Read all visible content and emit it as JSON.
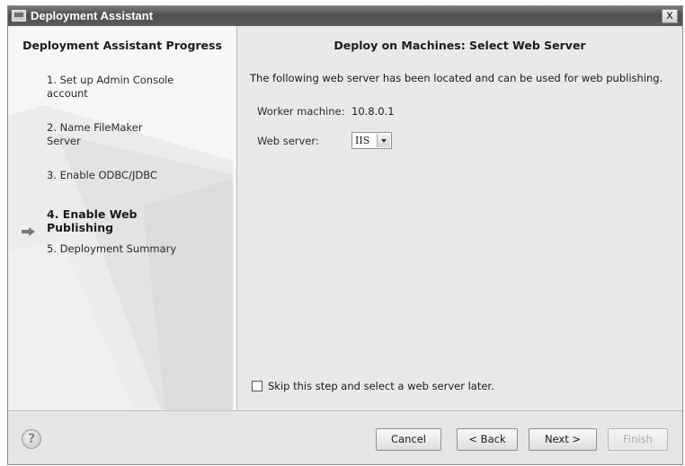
{
  "window": {
    "title": "Deployment Assistant",
    "close_glyph": "x"
  },
  "sidebar": {
    "heading": "Deployment Assistant Progress",
    "steps": [
      {
        "line1": "1. Set up Admin Console",
        "line2": "account"
      },
      {
        "line1": "2. Name FileMaker",
        "line2": "Server"
      },
      {
        "line1": "3. Enable ODBC/JDBC",
        "line2": ""
      },
      {
        "line1": "4. Enable Web Publishing",
        "line2": ""
      },
      {
        "line1": "5. Deployment Summary",
        "line2": ""
      }
    ],
    "active_step": 4,
    "arrow_icon": "right-arrow-icon"
  },
  "main": {
    "heading": "Deploy on Machines: Select Web Server",
    "description": "The following web server has been located and can be used for web publishing.",
    "worker_label": "Worker machine:",
    "worker_value": "10.8.0.1",
    "web_server_label": "Web server:",
    "web_server_value": "IIS",
    "skip_label": "Skip this step and select a web server later.",
    "skip_checked": false
  },
  "footer": {
    "help_glyph": "?",
    "cancel": "Cancel",
    "back": "< Back",
    "next": "Next >",
    "finish": "Finish"
  }
}
